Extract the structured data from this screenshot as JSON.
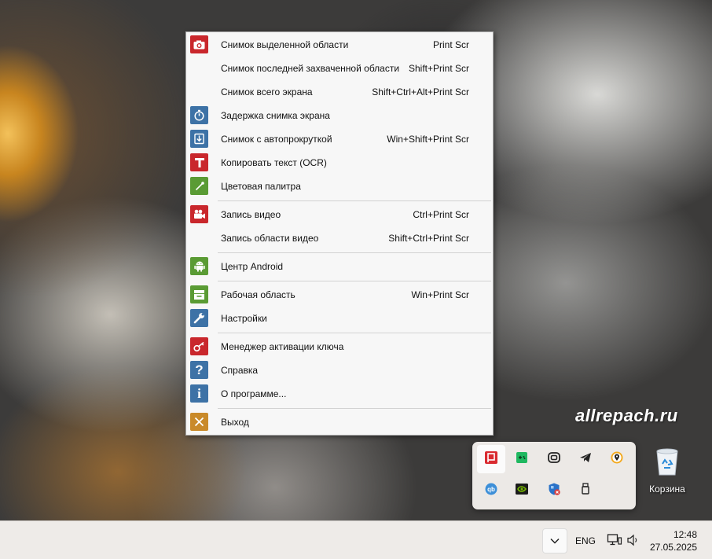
{
  "menu": {
    "items": [
      {
        "label": "Снимок выделенной области",
        "shortcut": "Print Scr",
        "icon": "camera-icon",
        "color": "#c9272c"
      },
      {
        "label": "Снимок последней захваченной области",
        "shortcut": "Shift+Print Scr",
        "icon": "",
        "color": ""
      },
      {
        "label": "Снимок всего экрана",
        "shortcut": "Shift+Ctrl+Alt+Print Scr",
        "icon": "",
        "color": ""
      },
      {
        "label": "Задержка снимка экрана",
        "shortcut": "",
        "icon": "stopwatch-icon",
        "color": "#3d72a6"
      },
      {
        "label": "Снимок с автопрокруткой",
        "shortcut": "Win+Shift+Print Scr",
        "icon": "scroll-capture-icon",
        "color": "#3d72a6"
      },
      {
        "label": "Копировать текст (OCR)",
        "shortcut": "",
        "icon": "text-t-icon",
        "color": "#c9272c"
      },
      {
        "label": "Цветовая палитра",
        "shortcut": "",
        "icon": "eyedropper-icon",
        "color": "#5a9b34"
      },
      {
        "label": "Запись видео",
        "shortcut": "Ctrl+Print Scr",
        "icon": "video-camera-icon",
        "color": "#c9272c"
      },
      {
        "label": "Запись области видео",
        "shortcut": "Shift+Ctrl+Print Scr",
        "icon": "",
        "color": ""
      },
      {
        "label": "Центр Android",
        "shortcut": "",
        "icon": "android-icon",
        "color": "#5a9b34"
      },
      {
        "label": "Рабочая область",
        "shortcut": "Win+Print Scr",
        "icon": "workspace-icon",
        "color": "#5a9b34"
      },
      {
        "label": "Настройки",
        "shortcut": "",
        "icon": "wrench-icon",
        "color": "#3d72a6"
      },
      {
        "label": "Менеджер активации ключа",
        "shortcut": "",
        "icon": "key-icon",
        "color": "#c9272c"
      },
      {
        "label": "Справка",
        "shortcut": "",
        "icon": "question-icon",
        "color": "#3d72a6"
      },
      {
        "label": "О программе...",
        "shortcut": "",
        "icon": "info-icon",
        "color": "#3d72a6"
      },
      {
        "label": "Выход",
        "shortcut": "",
        "icon": "close-x-icon",
        "color": "#c98a2a"
      }
    ]
  },
  "watermark": "allrepach.ru",
  "tray_popup": {
    "icons": [
      "faststone-capture-icon",
      "gamepad-icon",
      "copilot-icon",
      "telegram-icon",
      "location-pin-icon",
      "qbittorrent-icon",
      "nvidia-icon",
      "defender-icon",
      "usb-drive-icon"
    ]
  },
  "desktop": {
    "recycle_bin_label": "Корзина"
  },
  "taskbar": {
    "language": "ENG",
    "time": "12:48",
    "date": "27.05.2025"
  }
}
